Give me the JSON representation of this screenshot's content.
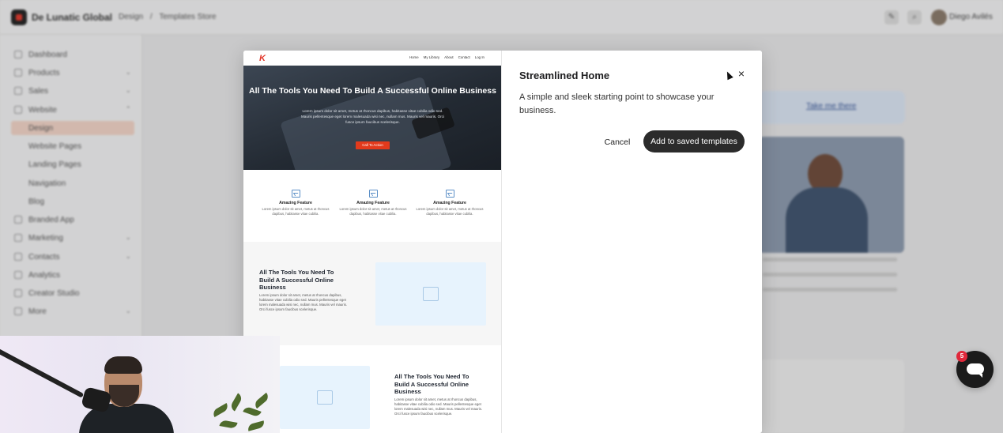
{
  "app": {
    "brand": "De Lunatic Global",
    "breadcrumb": [
      "Design",
      "/",
      "Templates Store"
    ],
    "user_name": "Diego Avilés",
    "sidebar": [
      {
        "label": "Dashboard"
      },
      {
        "label": "Products"
      },
      {
        "label": "Sales"
      },
      {
        "label": "Website"
      },
      {
        "label": "Design"
      },
      {
        "label": "Website Pages"
      },
      {
        "label": "Landing Pages"
      },
      {
        "label": "Navigation"
      },
      {
        "label": "Blog"
      },
      {
        "label": "Branded App"
      },
      {
        "label": "Marketing"
      },
      {
        "label": "Contacts"
      },
      {
        "label": "Analytics"
      },
      {
        "label": "Creator Studio"
      },
      {
        "label": "More"
      }
    ],
    "banner_link": "Take me there"
  },
  "modal": {
    "title": "Streamlined Home",
    "description": "A simple and sleek starting point to showcase your business.",
    "cancel_label": "Cancel",
    "save_label": "Add to saved templates",
    "close_icon": "×"
  },
  "preview": {
    "logo": "K",
    "nav_links": [
      "Home",
      "My Library",
      "About",
      "Contact",
      "Log In"
    ],
    "hero_title": "All The Tools You Need To Build A Successful Online Business",
    "hero_text": "Lorem ipsum dolor sit amet, metus at rhoncus dapibus, habitasse vitae cubilia odio sed. Mauris pellentesque eget lorem malesuada wisi nec, nullam mus. Mauris vel mauris. Orci fusce ipsum faucibus scelerisque.",
    "cta": "Call To Action",
    "features": [
      {
        "title": "Amazing Feature",
        "text": "Lorem ipsum dolor sit amet, metus at rhoncus dapibus, habitasse vitae cubilia."
      },
      {
        "title": "Amazing Feature",
        "text": "Lorem ipsum dolor sit amet, metus at rhoncus dapibus, habitasse vitae cubilia."
      },
      {
        "title": "Amazing Feature",
        "text": "Lorem ipsum dolor sit amet, metus at rhoncus dapibus, habitasse vitae cubilia."
      }
    ],
    "section2_title": "All The Tools You Need To Build A Successful Online Business",
    "section2_text": "Lorem ipsum dolor sit amet, metus at rhoncus dapibus, habitasse vitae cubilia odio sed. Mauris pellentesque eget lorem malesuada wisi nec, nullam mus. Mauris vel mauris. Orci fusce ipsum faucibus scelerisque.",
    "section3_title": "All The Tools You Need To Build A Successful Online Business",
    "section3_text": "Lorem ipsum dolor sit amet, metus at rhoncus dapibus, habitasse vitae cubilia odio sed. Mauris pellentesque eget lorem malesuada wisi nec, nullam mus. Mauris vel mauris. Orci fusce ipsum faucibus scelerisque."
  },
  "chat": {
    "badge_count": "5"
  },
  "colors": {
    "accent": "#e23a1c",
    "primary_button": "#2b2b2b",
    "badge": "#e0283b"
  }
}
